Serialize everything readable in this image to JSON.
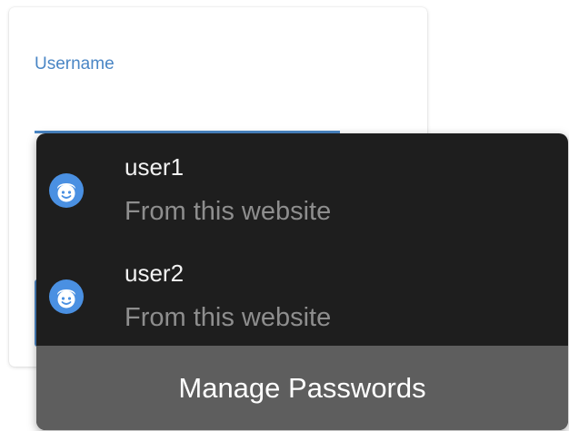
{
  "form": {
    "username_label": "Username",
    "username_value": ""
  },
  "autofill": {
    "suggestions": [
      {
        "username": "user1",
        "origin": "From this website",
        "icon": "user-avatar-icon"
      },
      {
        "username": "user2",
        "origin": "From this website",
        "icon": "user-avatar-icon"
      }
    ],
    "manage_label": "Manage Passwords"
  },
  "colors": {
    "accent": "#4a86c5",
    "popup_bg": "#1e1e1e",
    "manage_bg": "#5e5e5e",
    "avatar_bg": "#4a90e2"
  }
}
